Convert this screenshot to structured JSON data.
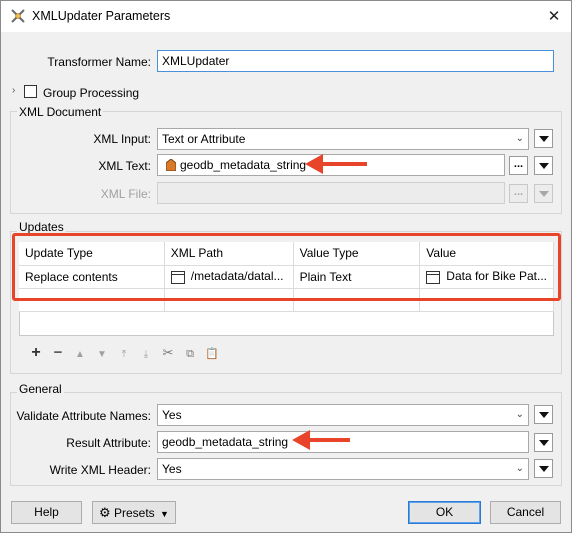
{
  "window": {
    "title": "XMLUpdater Parameters"
  },
  "transformer": {
    "label": "Transformer Name:",
    "value": "XMLUpdater"
  },
  "group_processing": {
    "label": "Group Processing"
  },
  "xml_document": {
    "title": "XML Document",
    "input_label": "XML Input:",
    "input_value": "Text or Attribute",
    "text_label": "XML Text:",
    "text_value": "geodb_metadata_string",
    "file_label": "XML File:",
    "ellipsis": "..."
  },
  "updates": {
    "title": "Updates",
    "columns": [
      "Update Type",
      "XML Path",
      "Value Type",
      "Value"
    ],
    "rows": [
      [
        "Replace contents",
        "/metadata/datal...",
        "Plain Text",
        "Data for Bike Pat..."
      ]
    ]
  },
  "general": {
    "title": "General",
    "validate_label": "Validate Attribute Names:",
    "validate_value": "Yes",
    "result_label": "Result Attribute:",
    "result_value": "geodb_metadata_string",
    "header_label": "Write XML Header:",
    "header_value": "Yes"
  },
  "buttons": {
    "help": "Help",
    "presets": "Presets",
    "ok": "OK",
    "cancel": "Cancel"
  },
  "colors": {
    "annotation": "#e8442a",
    "focus": "#4a90d9"
  }
}
